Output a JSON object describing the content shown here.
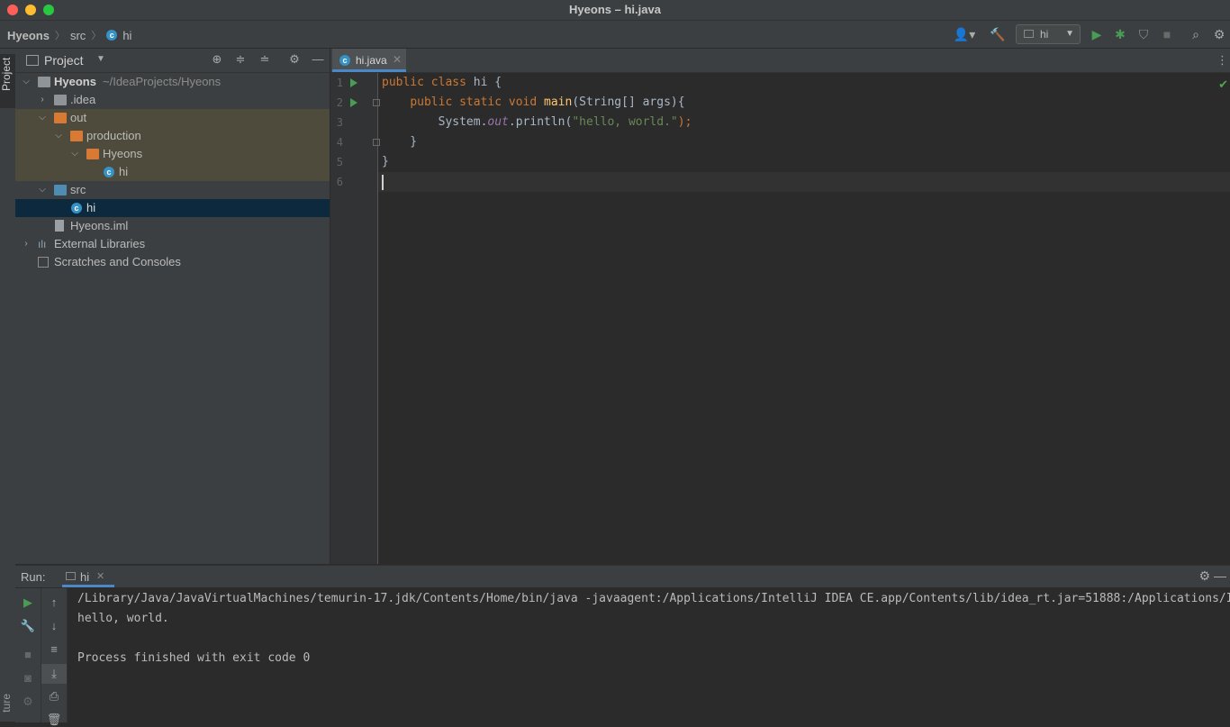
{
  "window": {
    "title": "Hyeons – hi.java"
  },
  "breadcrumb": {
    "project": "Hyeons",
    "folder": "src",
    "file": "hi"
  },
  "toolbar": {
    "run_config": "hi"
  },
  "sidebar": {
    "tab_label": "Project",
    "bottom_tab_label": "ture"
  },
  "project_panel": {
    "title": "Project",
    "tree": [
      {
        "label": "Hyeons",
        "path": "~/IdeaProjects/Hyeons"
      },
      {
        "label": ".idea"
      },
      {
        "label": "out"
      },
      {
        "label": "production"
      },
      {
        "label": "Hyeons"
      },
      {
        "label": "hi"
      },
      {
        "label": "src"
      },
      {
        "label": "hi"
      },
      {
        "label": "Hyeons.iml"
      },
      {
        "label": "External Libraries"
      },
      {
        "label": "Scratches and Consoles"
      }
    ]
  },
  "editor": {
    "tab_label": "hi.java",
    "line_numbers": [
      "1",
      "2",
      "3",
      "4",
      "5",
      "6"
    ]
  },
  "run_panel": {
    "label": "Run:",
    "tab_label": "hi",
    "console": [
      "/Library/Java/JavaVirtualMachines/temurin-17.jdk/Contents/Home/bin/java -javaagent:/Applications/IntelliJ IDEA CE.app/Contents/lib/idea_rt.jar=51888:/Applications/I",
      "hello, world.",
      "",
      "Process finished with exit code 0"
    ]
  }
}
